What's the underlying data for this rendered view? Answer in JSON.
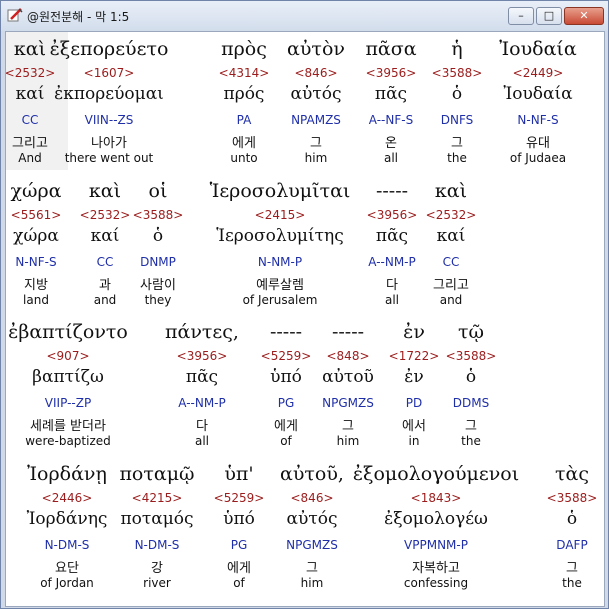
{
  "window": {
    "title": "@원전분해 - 막 1:5",
    "minimize": "–",
    "maximize": "□",
    "close": "✕"
  },
  "rows": [
    {
      "words": [
        {
          "greek": "καὶ",
          "strong": "<2532>",
          "lemma": "καί",
          "parse": "CC",
          "korean": "그리고",
          "english": "And"
        },
        {
          "greek": "ἐξεπορεύετο",
          "strong": "<1607>",
          "lemma": "ἐκπορεύομαι",
          "parse": "VIIN--ZS",
          "korean": "나아가",
          "english": "there went out"
        },
        {
          "greek": "πρὸς",
          "strong": "<4314>",
          "lemma": "πρός",
          "parse": "PA",
          "korean": "에게",
          "english": "unto"
        },
        {
          "greek": "αὐτὸν",
          "strong": "<846>",
          "lemma": "αὐτός",
          "parse": "NPAMZS",
          "korean": "그",
          "english": "him"
        },
        {
          "greek": "πᾶσα",
          "strong": "<3956>",
          "lemma": "πᾶς",
          "parse": "A--NF-S",
          "korean": "온",
          "english": "all"
        },
        {
          "greek": "ἡ",
          "strong": "<3588>",
          "lemma": "ὁ",
          "parse": "DNFS",
          "korean": "그",
          "english": "the"
        },
        {
          "greek": "Ἰουδαία",
          "strong": "<2449>",
          "lemma": "Ἰουδαία",
          "parse": "N-NF-S",
          "korean": "유대",
          "english": "of Judaea"
        }
      ]
    },
    {
      "words": [
        {
          "greek": "χώρα",
          "strong": "<5561>",
          "lemma": "χώρα",
          "parse": "N-NF-S",
          "korean": "지방",
          "english": "land"
        },
        {
          "greek": "καὶ",
          "strong": "<2532>",
          "lemma": "καί",
          "parse": "CC",
          "korean": "과",
          "english": "and"
        },
        {
          "greek": "οἱ",
          "strong": "<3588>",
          "lemma": "ὁ",
          "parse": "DNMP",
          "korean": "사람이",
          "english": "they"
        },
        {
          "greek": "Ἱεροσολυμῖται",
          "strong": "<2415>",
          "lemma": "Ἱεροσολυμίτης",
          "parse": "N-NM-P",
          "korean": "예루살렘",
          "english": "of Jerusalem"
        },
        {
          "greek": "-----",
          "strong": "<3956>",
          "lemma": "πᾶς",
          "parse": "A--NM-P",
          "korean": "다",
          "english": "all"
        },
        {
          "greek": "καὶ",
          "strong": "<2532>",
          "lemma": "καί",
          "parse": "CC",
          "korean": "그리고",
          "english": "and"
        }
      ]
    },
    {
      "words": [
        {
          "greek": "ἐβαπτίζοντο",
          "strong": "<907>",
          "lemma": "βαπτίζω",
          "parse": "VIIP--ZP",
          "korean": "세례를 받더라",
          "english": "were-baptized"
        },
        {
          "greek": "πάντες,",
          "strong": "<3956>",
          "lemma": "πᾶς",
          "parse": "A--NM-P",
          "korean": "다",
          "english": "all"
        },
        {
          "greek": "-----",
          "strong": "<5259>",
          "lemma": "ὑπό",
          "parse": "PG",
          "korean": "에게",
          "english": "of"
        },
        {
          "greek": "-----",
          "strong": "<848>",
          "lemma": "αὐτοῦ",
          "parse": "NPGMZS",
          "korean": "그",
          "english": "him"
        },
        {
          "greek": "ἐν",
          "strong": "<1722>",
          "lemma": "ἐν",
          "parse": "PD",
          "korean": "에서",
          "english": "in"
        },
        {
          "greek": "τῷ",
          "strong": "<3588>",
          "lemma": "ὁ",
          "parse": "DDMS",
          "korean": "그",
          "english": "the"
        }
      ]
    },
    {
      "words": [
        {
          "greek": "Ἰορδάνῃ",
          "strong": "<2446>",
          "lemma": "Ἰορδάνης",
          "parse": "N-DM-S",
          "korean": "요단",
          "english": "of Jordan"
        },
        {
          "greek": "ποταμῷ",
          "strong": "<4215>",
          "lemma": "ποταμός",
          "parse": "N-DM-S",
          "korean": "강",
          "english": "river"
        },
        {
          "greek": "ὑπ'",
          "strong": "<5259>",
          "lemma": "ὑπό",
          "parse": "PG",
          "korean": "에게",
          "english": "of"
        },
        {
          "greek": "αὐτοῦ,",
          "strong": "<846>",
          "lemma": "αὐτός",
          "parse": "NPGMZS",
          "korean": "그",
          "english": "him"
        },
        {
          "greek": "ἐξομολογούμενοι",
          "strong": "<1843>",
          "lemma": "ἐξομολογέω",
          "parse": "VPPMNM-P",
          "korean": "자복하고",
          "english": "confessing"
        },
        {
          "greek": "τὰς",
          "strong": "<3588>",
          "lemma": "ὁ",
          "parse": "DAFP",
          "korean": "그",
          "english": "the"
        }
      ]
    }
  ]
}
